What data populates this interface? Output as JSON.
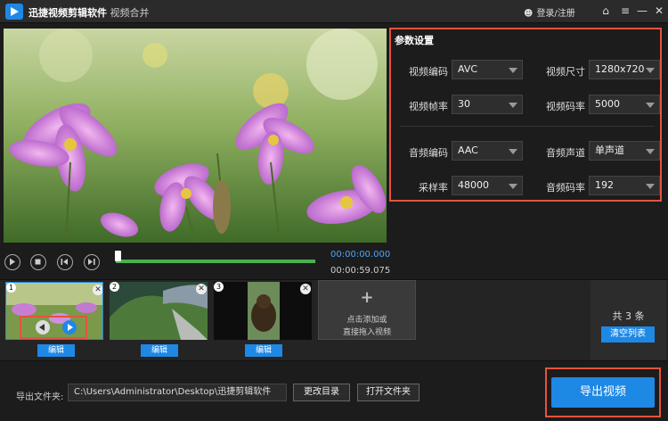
{
  "titlebar": {
    "app_name": "迅捷视频剪辑软件",
    "separator_title": "- 视频合并",
    "login": "登录/注册"
  },
  "params": {
    "title": "参数设置",
    "video_codec_label": "视频编码",
    "video_codec": "AVC",
    "video_size_label": "视频尺寸",
    "video_size": "1280x720",
    "frame_rate_label": "视频帧率",
    "frame_rate": "30",
    "video_bitrate_label": "视频码率",
    "video_bitrate": "5000",
    "audio_codec_label": "音频编码",
    "audio_codec": "AAC",
    "audio_channel_label": "音频声道",
    "audio_channel": "单声道",
    "sample_rate_label": "采样率",
    "sample_rate": "48000",
    "audio_bitrate_label": "音频码率",
    "audio_bitrate": "192"
  },
  "player": {
    "current_time": "00:00:00.000",
    "total_time": "00:00:59.075",
    "progress": 0.0
  },
  "clips": [
    {
      "num": "1",
      "edit": "编辑"
    },
    {
      "num": "2",
      "edit": "编辑"
    },
    {
      "num": "3",
      "edit": "编辑"
    }
  ],
  "add_box": {
    "line1": "点击添加或",
    "line2": "直接拖入视频"
  },
  "count": {
    "text": "共 3 条",
    "clear_label": "清空列表"
  },
  "output": {
    "label": "导出文件夹:",
    "path": "C:\\Users\\Administrator\\Desktop\\迅捷剪辑软件",
    "change_dir": "更改目录",
    "open_folder": "打开文件夹",
    "export": "导出视频"
  },
  "colors": {
    "accent": "#1e88e5",
    "highlight": "#e5533d",
    "progress": "#4caf50"
  }
}
